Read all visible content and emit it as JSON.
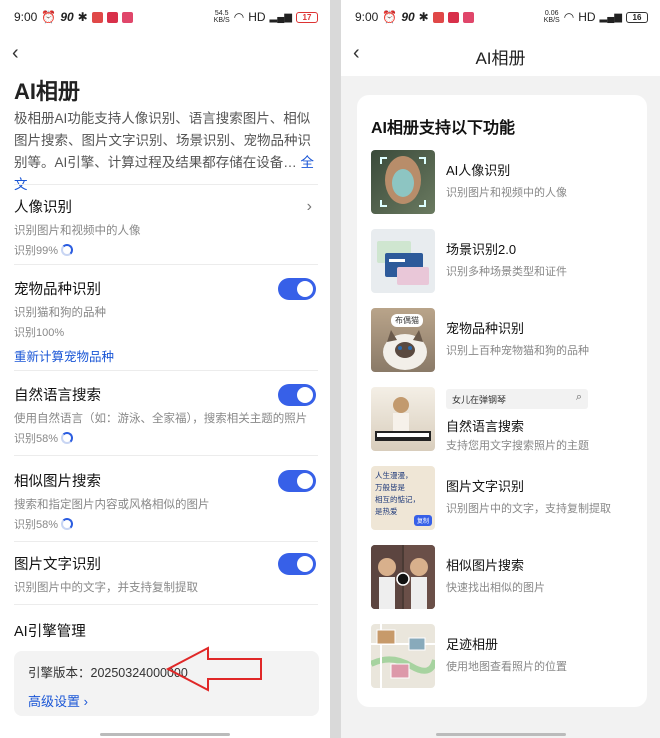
{
  "left": {
    "status": {
      "time": "9:00",
      "speed": "90",
      "speed2": "54.5\nKB/S",
      "hd": "HD",
      "battery": "17"
    },
    "title": "AI相册",
    "intro": "极相册AI功能支持人像识别、语言搜索图片、相似图片搜索、图片文字识别、场景识别、宠物品种识别等。AI引擎、计算过程及结果都存储在设备…",
    "intro_more": "全文",
    "sections": [
      {
        "title": "人像识别",
        "desc": "识别图片和视频中的人像",
        "status": "识别99%"
      },
      {
        "title": "宠物品种识别",
        "desc": "识别猫和狗的品种",
        "status": "识别100%",
        "link": "重新计算宠物品种"
      },
      {
        "title": "自然语言搜索",
        "desc": "使用自然语言（如：游泳、全家福），搜索相关主题的照片",
        "status": "识别58%"
      },
      {
        "title": "相似图片搜索",
        "desc": "搜索和指定图片内容或风格相似的图片",
        "status": "识别58%"
      },
      {
        "title": "图片文字识别",
        "desc": "识别图片中的文字，并支持复制提取"
      }
    ],
    "engine_title": "AI引擎管理",
    "engine_version": "引擎版本：20250324000000",
    "advanced": "高级设置 ›"
  },
  "right": {
    "status": {
      "time": "9:00",
      "speed": "90",
      "speed2": "0.06\nKB/S",
      "hd": "HD",
      "battery": "16"
    },
    "title": "AI相册",
    "card_title": "AI相册支持以下功能",
    "features": [
      {
        "title": "AI人像识别",
        "desc": "识别图片和视频中的人像"
      },
      {
        "title": "场景识别2.0",
        "desc": "识别多种场景类型和证件"
      },
      {
        "title": "宠物品种识别",
        "desc": "识别上百种宠物猫和狗的品种",
        "badge": "布偶猫"
      },
      {
        "title": "自然语言搜索",
        "desc": "支持您用文字搜索照片的主题",
        "search": "女儿在弹钢琴"
      },
      {
        "title": "图片文字识别",
        "desc": "识别图片中的文字，支持复制提取",
        "ocr_text": "人生漫漫，\n万般皆是\n相互的惦记，\n是热爱",
        "ocr_copy": "复制"
      },
      {
        "title": "相似图片搜索",
        "desc": "快速找出相似的图片"
      },
      {
        "title": "足迹相册",
        "desc": "使用地图查看照片的位置"
      }
    ]
  },
  "colors": {
    "accent": "#3760e8",
    "link": "#1a56d6",
    "arrow": "#e02828"
  }
}
